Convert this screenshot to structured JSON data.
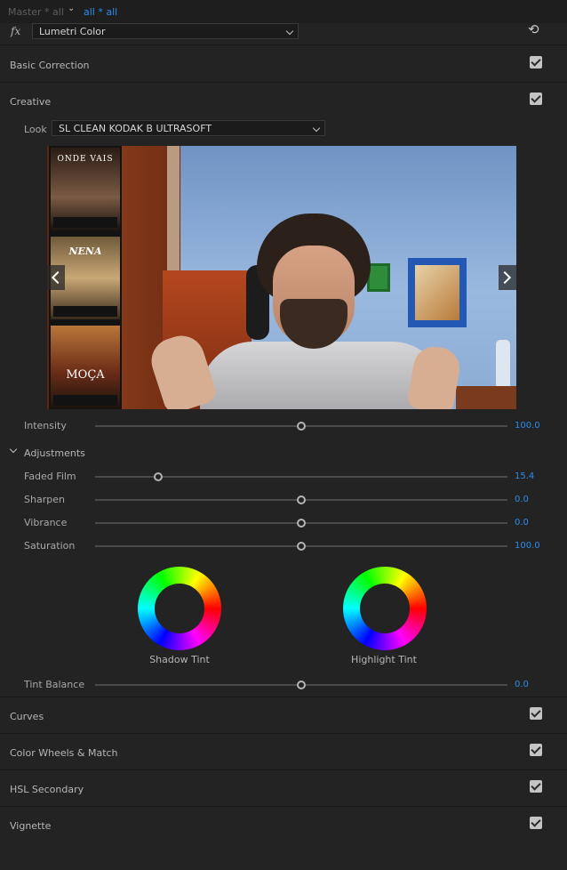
{
  "header": {
    "master_label": "Master * all",
    "clip_label": "all * all"
  },
  "effect": {
    "fx_symbol": "fx",
    "name": "Lumetri Color"
  },
  "sections": {
    "basic_correction": "Basic Correction",
    "creative": "Creative",
    "curves": "Curves",
    "color_wheels_match": "Color Wheels & Match",
    "hsl_secondary": "HSL Secondary",
    "vignette": "Vignette"
  },
  "creative": {
    "look_label": "Look",
    "look_value": "SL CLEAN KODAK B ULTRASOFT",
    "preview_posters": [
      "ONDE VAIS",
      "NENA",
      "MOÇA"
    ],
    "intensity": {
      "label": "Intensity",
      "value": "100.0",
      "fraction": 0.5
    },
    "adjustments_label": "Adjustments",
    "adjustments": [
      {
        "label": "Faded Film",
        "value": "15.4",
        "fraction": 0.154
      },
      {
        "label": "Sharpen",
        "value": "0.0",
        "fraction": 0.5
      },
      {
        "label": "Vibrance",
        "value": "0.0",
        "fraction": 0.5
      },
      {
        "label": "Saturation",
        "value": "100.0",
        "fraction": 0.5
      }
    ],
    "shadow_tint_label": "Shadow Tint",
    "highlight_tint_label": "Highlight Tint",
    "tint_balance": {
      "label": "Tint Balance",
      "value": "0.0",
      "fraction": 0.5
    }
  },
  "colors": {
    "accent_value": "#2d8ceb",
    "panel_bg": "#232323"
  },
  "icons": {
    "reset": "reset-icon",
    "checkbox": "checkbox-checked-icon",
    "dropdown": "chevron-down-icon",
    "prev": "chevron-left-icon",
    "next": "chevron-right-icon"
  }
}
